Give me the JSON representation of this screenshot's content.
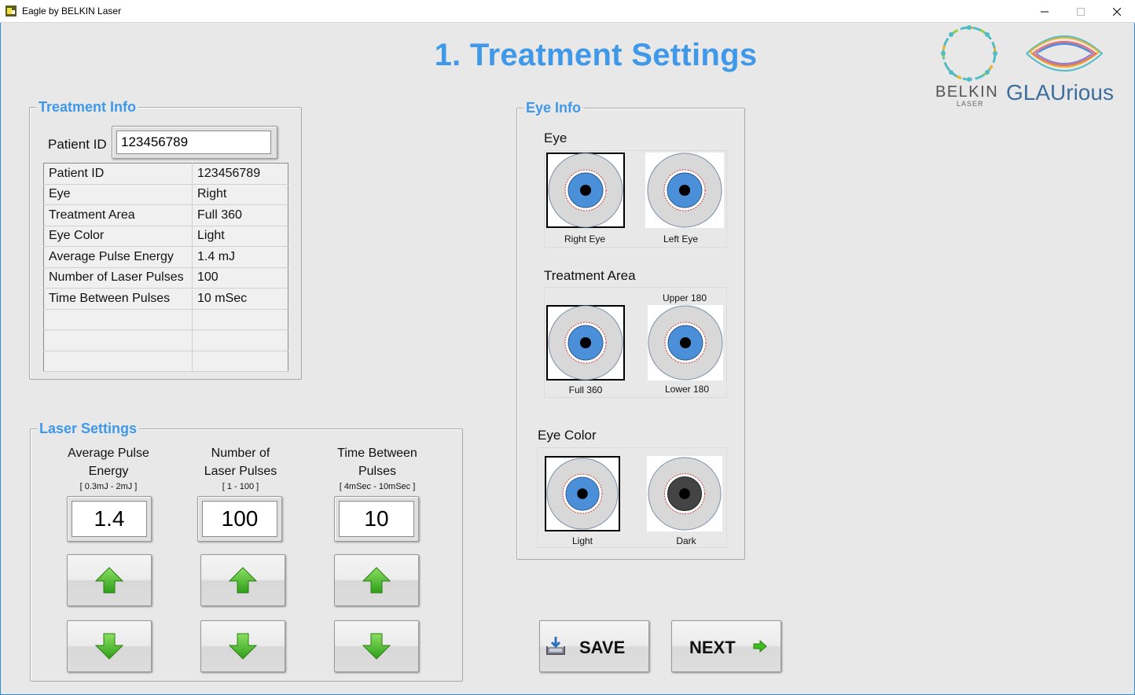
{
  "window": {
    "title": "Eagle by BELKIN Laser"
  },
  "page_title": "1. Treatment Settings",
  "logos": {
    "belkin_text": "BELKIN",
    "belkin_sub": "LASER",
    "glaurious_text": "GLAUrious"
  },
  "treatment_info": {
    "legend": "Treatment Info",
    "patient_id_label": "Patient ID",
    "patient_id_value": "123456789",
    "rows": [
      {
        "label": "Patient ID",
        "value": "123456789"
      },
      {
        "label": "Eye",
        "value": "Right"
      },
      {
        "label": "Treatment Area",
        "value": "Full 360"
      },
      {
        "label": "Eye Color",
        "value": "Light"
      },
      {
        "label": "Average Pulse Energy",
        "value": "1.4 mJ"
      },
      {
        "label": "Number of Laser Pulses",
        "value": "100"
      },
      {
        "label": "Time Between Pulses",
        "value": "10 mSec"
      },
      {
        "label": "",
        "value": ""
      },
      {
        "label": "",
        "value": ""
      },
      {
        "label": "",
        "value": ""
      }
    ]
  },
  "laser_settings": {
    "legend": "Laser Settings",
    "controls": [
      {
        "label_line1": "Average Pulse",
        "label_line2": "Energy",
        "range": "[ 0.3mJ - 2mJ ]",
        "value": "1.4"
      },
      {
        "label_line1": "Number of",
        "label_line2": "Laser Pulses",
        "range": "[ 1 - 100 ]",
        "value": "100"
      },
      {
        "label_line1": "Time Between",
        "label_line2": "Pulses",
        "range": "[ 4mSec - 10mSec ]",
        "value": "10"
      }
    ]
  },
  "eye_info": {
    "legend": "Eye Info",
    "eye": {
      "label": "Eye",
      "options": [
        "Right Eye",
        "Left Eye"
      ],
      "selected": "Right Eye"
    },
    "area": {
      "label": "Treatment Area",
      "options": [
        "Full 360",
        "Upper 180",
        "Lower 180"
      ],
      "selected": "Full 360"
    },
    "color": {
      "label": "Eye Color",
      "options": [
        "Light",
        "Dark"
      ],
      "selected": "Light"
    }
  },
  "buttons": {
    "save": "SAVE",
    "next": "NEXT"
  },
  "colors": {
    "accent": "#3f98e8",
    "iris_light": "#4a8fd8",
    "iris_dark": "#444444",
    "arrow_green": "#3fbf1f"
  }
}
